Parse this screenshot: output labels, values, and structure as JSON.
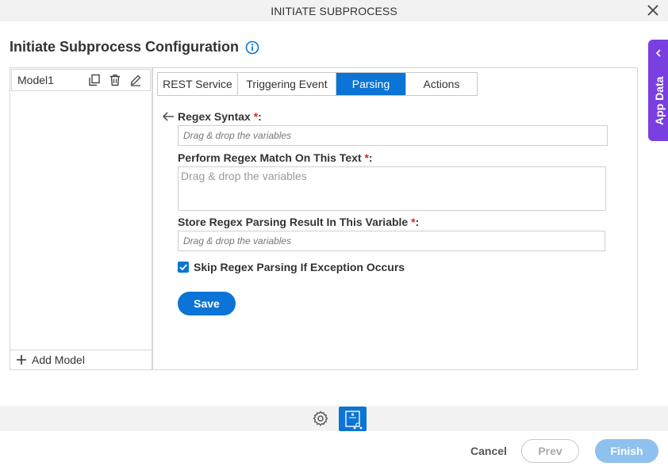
{
  "dialog": {
    "title": "INITIATE SUBPROCESS"
  },
  "page": {
    "heading": "Initiate Subprocess Configuration"
  },
  "models": {
    "items": [
      {
        "name": "Model1"
      }
    ],
    "add_label": "Add Model"
  },
  "tabs": [
    {
      "label": "REST Service",
      "active": false
    },
    {
      "label": "Triggering Event",
      "active": false
    },
    {
      "label": "Parsing",
      "active": true
    },
    {
      "label": "Actions",
      "active": false
    }
  ],
  "form": {
    "regex_syntax": {
      "label": "Regex Syntax",
      "required_mark": "*",
      "suffix": ":",
      "placeholder": "Drag & drop the variables"
    },
    "match_text": {
      "label": "Perform Regex Match On This Text",
      "required_mark": "*",
      "suffix": ":",
      "placeholder": "Drag & drop the variables"
    },
    "store_result": {
      "label": "Store Regex Parsing Result In This Variable",
      "required_mark": "*",
      "suffix": ":",
      "placeholder": "Drag & drop the variables"
    },
    "skip_exception": {
      "label": "Skip Regex Parsing If Exception Occurs",
      "checked": true
    },
    "save_label": "Save"
  },
  "side_tab": {
    "label": "App Data"
  },
  "footer": {
    "cancel": "Cancel",
    "prev": "Prev",
    "finish": "Finish"
  },
  "colors": {
    "primary": "#0b74d6",
    "side_tab": "#7a3fe0",
    "required": "#e02020",
    "finish_disabled": "#8fc1ef"
  },
  "icons": [
    "close-icon",
    "info-icon",
    "copy-icon",
    "trash-icon",
    "edit-icon",
    "plus-icon",
    "back-arrow-icon",
    "checkmark-icon",
    "chevron-left-icon",
    "gear-icon",
    "model-icon"
  ]
}
